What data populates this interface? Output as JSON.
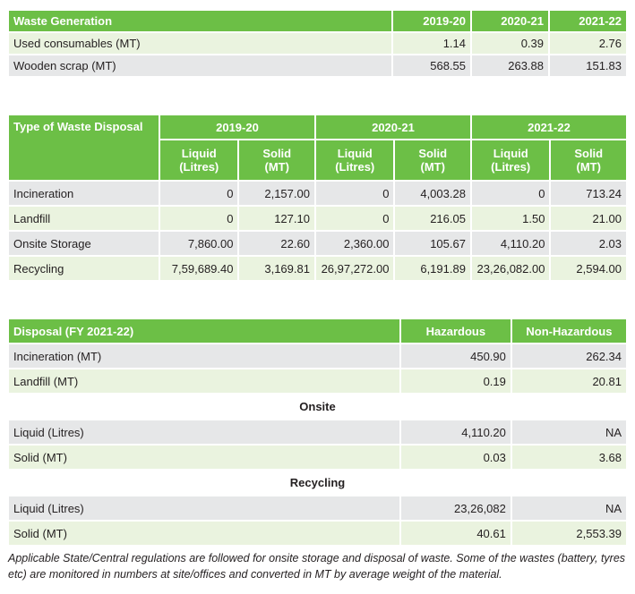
{
  "table1": {
    "header": [
      "Waste Generation",
      "2019-20",
      "2020-21",
      "2021-22"
    ],
    "rows": [
      [
        "Used consumables (MT)",
        "1.14",
        "0.39",
        "2.76"
      ],
      [
        "Wooden scrap (MT)",
        "568.55",
        "263.88",
        "151.83"
      ]
    ]
  },
  "table2": {
    "title": "Type of Waste Disposal",
    "years": [
      "2019-20",
      "2020-21",
      "2021-22"
    ],
    "sub": [
      "Liquid\n(Litres)",
      "Solid\n(MT)"
    ],
    "rows": [
      [
        "Incineration",
        "0",
        "2,157.00",
        "0",
        "4,003.28",
        "0",
        "713.24"
      ],
      [
        "Landfill",
        "0",
        "127.10",
        "0",
        "216.05",
        "1.50",
        "21.00"
      ],
      [
        "Onsite Storage",
        "7,860.00",
        "22.60",
        "2,360.00",
        "105.67",
        "4,110.20",
        "2.03"
      ],
      [
        "Recycling",
        "7,59,689.40",
        "3,169.81",
        "26,97,272.00",
        "6,191.89",
        "23,26,082.00",
        "2,594.00"
      ]
    ]
  },
  "table3": {
    "header": [
      "Disposal (FY 2021-22)",
      "Hazardous",
      "Non-Hazardous"
    ],
    "rows": [
      [
        "Incineration (MT)",
        "450.90",
        "262.34"
      ],
      [
        "Landfill (MT)",
        "0.19",
        "20.81"
      ]
    ],
    "onsite": {
      "label": "Onsite",
      "rows": [
        [
          "Liquid (Litres)",
          "4,110.20",
          "NA"
        ],
        [
          "Solid (MT)",
          "0.03",
          "3.68"
        ]
      ]
    },
    "recycling": {
      "label": "Recycling",
      "rows": [
        [
          "Liquid (Litres)",
          "23,26,082",
          "NA"
        ],
        [
          "Solid (MT)",
          "40.61",
          "2,553.39"
        ]
      ]
    }
  },
  "note": "Applicable State/Central regulations are followed for onsite storage and disposal of waste. Some of the wastes (battery, tyres etc) are monitored in numbers at site/offices and converted in MT by average weight of the material.",
  "colors": {
    "header_green": "#6cbf46",
    "row_light": "#eaf3df",
    "row_grey": "#e6e7e8"
  }
}
